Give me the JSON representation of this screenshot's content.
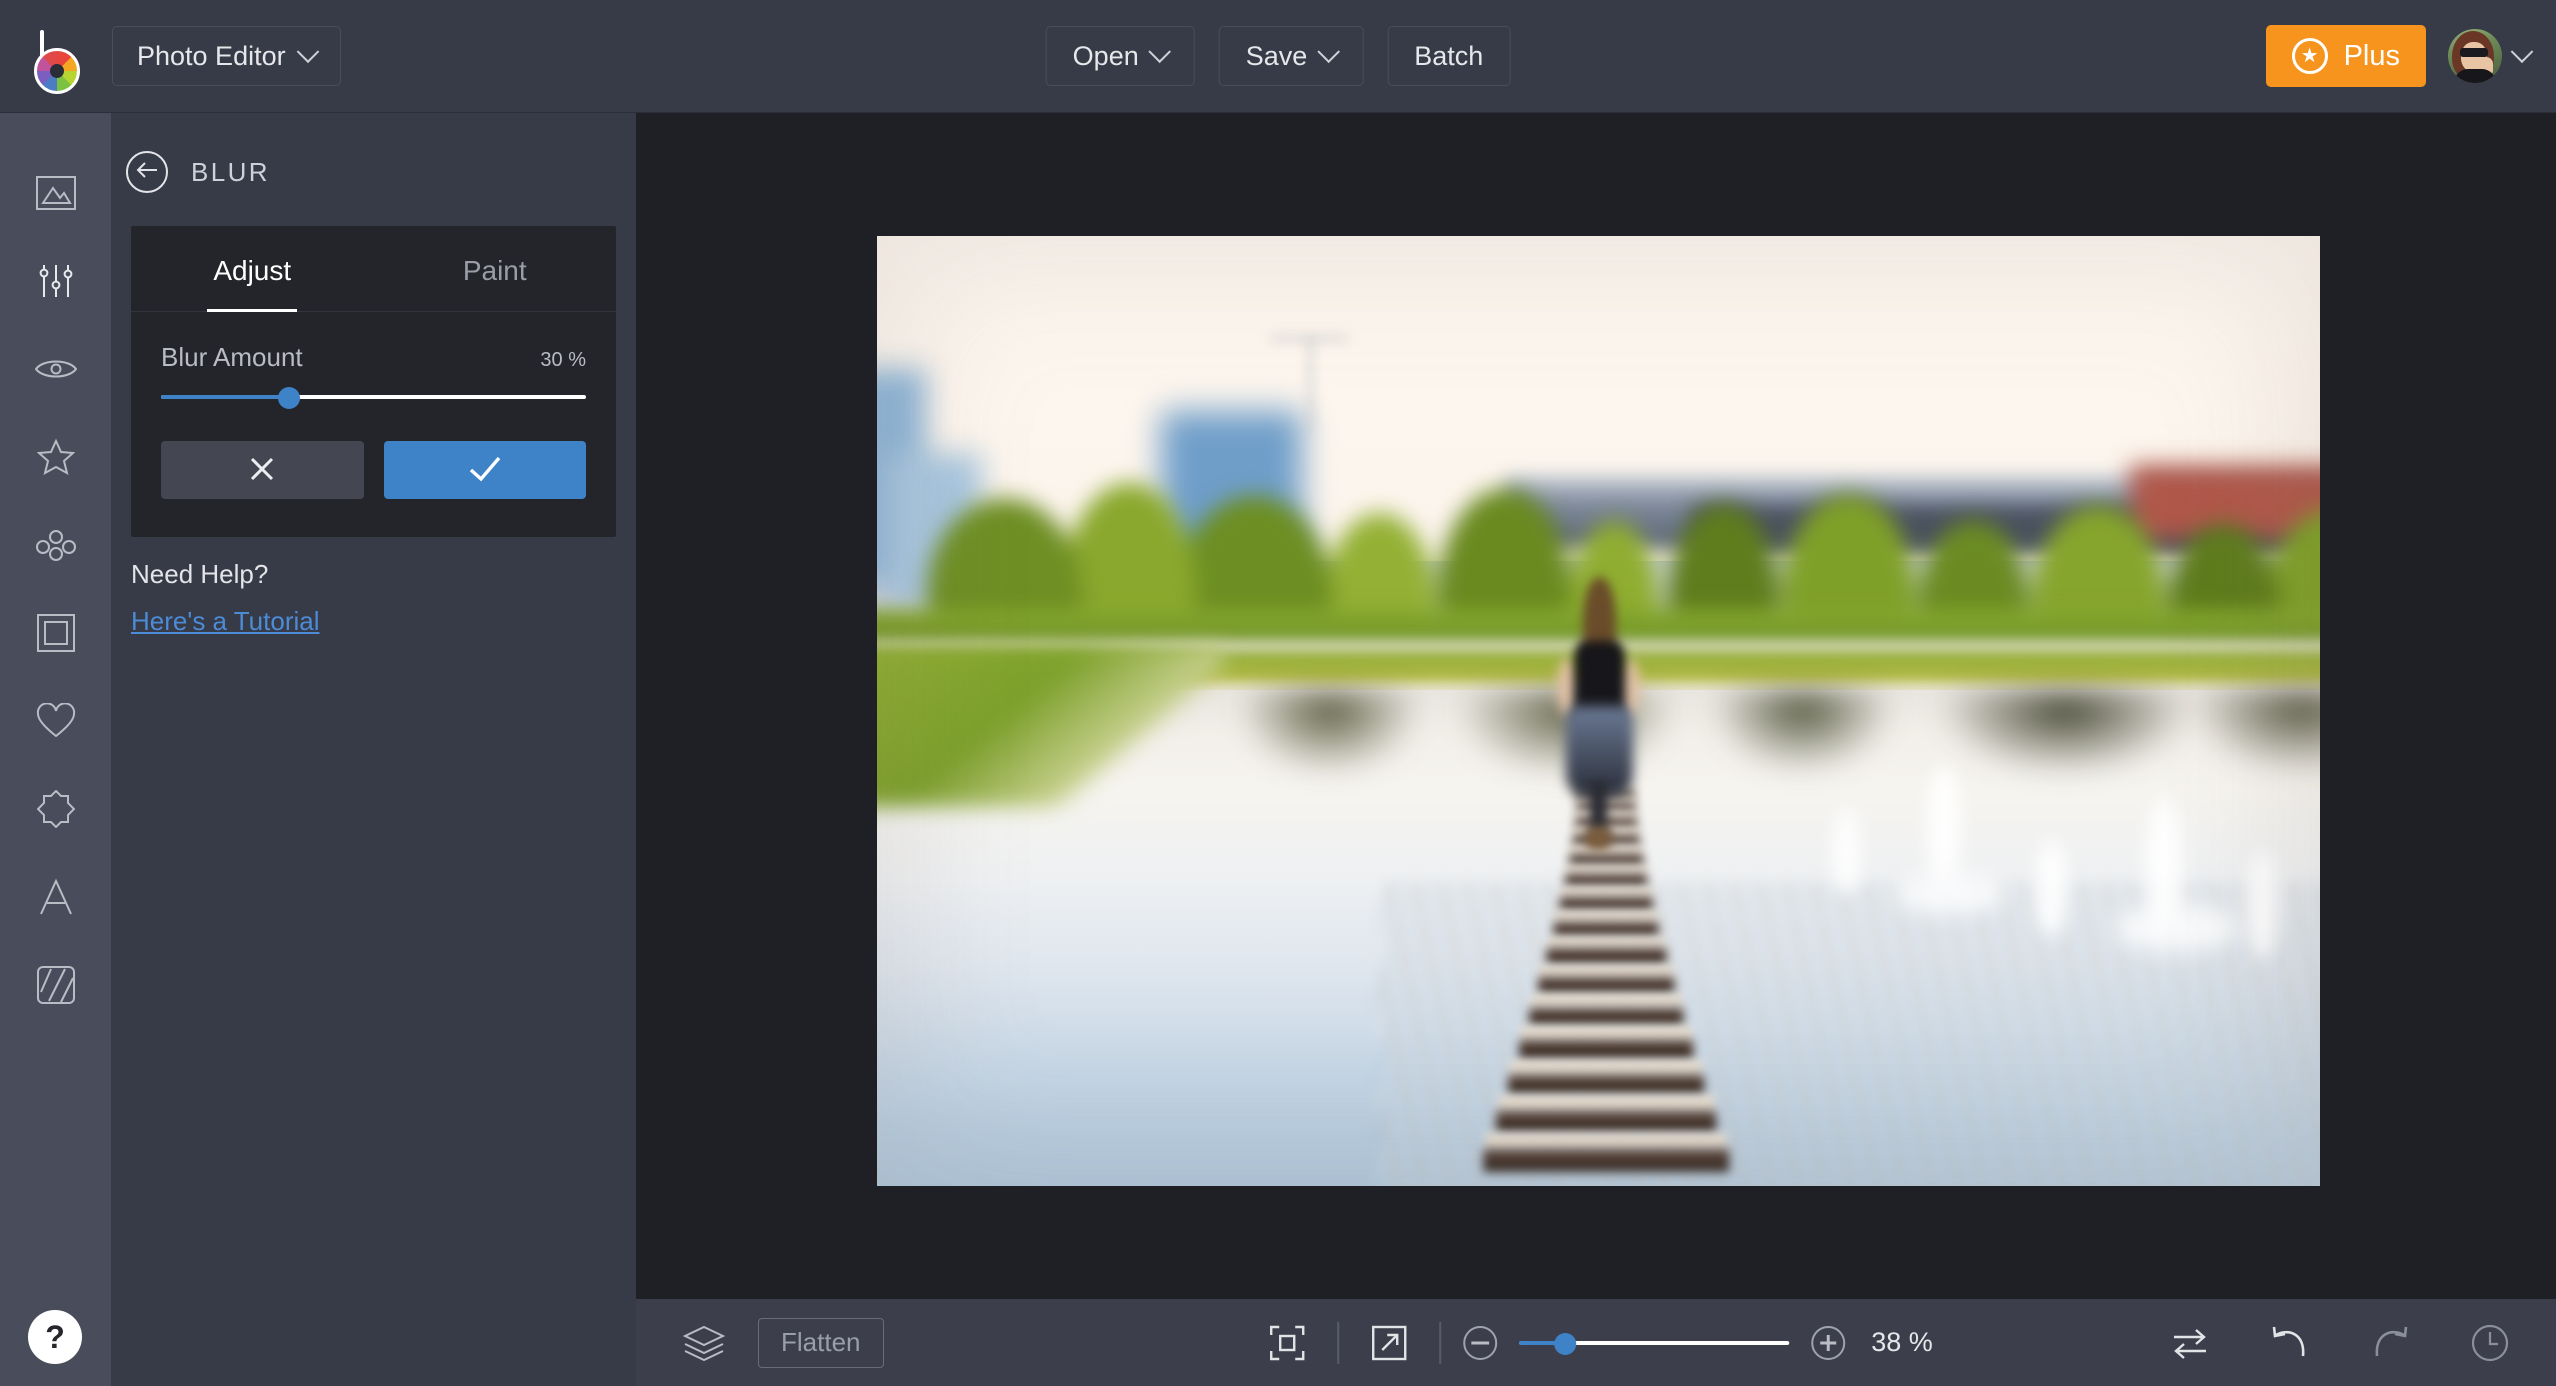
{
  "app": {
    "logo_icon": "befunky-shutter-logo",
    "mode_menu_label": "Photo Editor"
  },
  "topbar": {
    "open_label": "Open",
    "save_label": "Save",
    "batch_label": "Batch",
    "plus_label": "Plus",
    "plus_color": "#f7941e",
    "star_icon": "star-icon",
    "avatar_icon": "user-avatar"
  },
  "rail": {
    "items": [
      {
        "name": "image-tools",
        "icon": "mountain-photo-icon"
      },
      {
        "name": "edit-tools",
        "icon": "sliders-icon",
        "active": true
      },
      {
        "name": "touch-up-tools",
        "icon": "eye-icon"
      },
      {
        "name": "effects",
        "icon": "star-icon"
      },
      {
        "name": "artsy",
        "icon": "dots-cluster-icon"
      },
      {
        "name": "frames",
        "icon": "square-frame-icon"
      },
      {
        "name": "overlays",
        "icon": "heart-icon"
      },
      {
        "name": "graphics",
        "icon": "starburst-icon"
      },
      {
        "name": "text",
        "icon": "letter-a-icon"
      },
      {
        "name": "textures",
        "icon": "diagonal-lines-icon"
      }
    ],
    "help_label": "?"
  },
  "panel": {
    "back_icon": "back-arrow-icon",
    "title": "BLUR",
    "tabs": [
      {
        "label": "Adjust",
        "active": true
      },
      {
        "label": "Paint",
        "active": false
      }
    ],
    "slider": {
      "label": "Blur Amount",
      "value_text": "30 %",
      "value": 30,
      "min": 0,
      "max": 100,
      "accent": "#3e82c8"
    },
    "cancel_icon": "close-x-icon",
    "apply_icon": "check-icon",
    "need_help_label": "Need Help?",
    "tutorial_link_label": "Here's a Tutorial"
  },
  "canvas": {
    "image_alt": "Blurred photo of a woman walking on a wooden dock over a lake with fountains, trees and a bridge in the background"
  },
  "bottombar": {
    "layers_icon": "layers-icon",
    "flatten_label": "Flatten",
    "fit_icon": "fit-to-screen-icon",
    "expand_icon": "expand-arrow-icon",
    "zoom_out_icon": "minus-icon",
    "zoom_in_icon": "plus-icon",
    "zoom_value_text": "38 %",
    "zoom_value": 38,
    "zoom_min": 0,
    "zoom_max": 100,
    "compare_icon": "compare-arrows-icon",
    "undo_icon": "undo-arrow-icon",
    "redo_icon": "redo-arrow-icon",
    "history_icon": "clock-history-icon"
  }
}
